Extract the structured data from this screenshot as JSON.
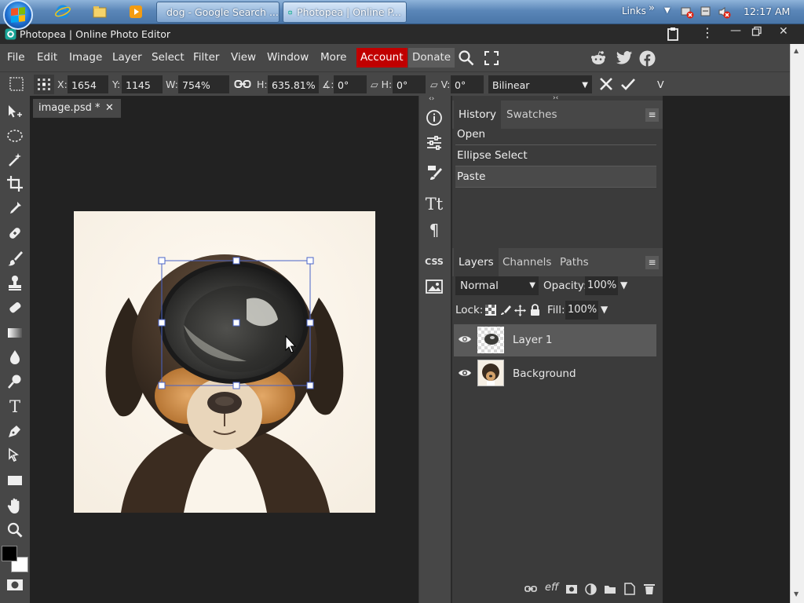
{
  "taskbar": {
    "tabs": [
      {
        "label": "dog - Google Search ...",
        "icon": "chrome-icon"
      },
      {
        "label": "Photopea | Online P...",
        "icon": "photopea-icon"
      }
    ],
    "links_label": "Links",
    "links_chevron": "»",
    "clock": "12:17 AM"
  },
  "app": {
    "title": "Photopea | Online Photo Editor"
  },
  "menu": {
    "items": [
      "File",
      "Edit",
      "Image",
      "Layer",
      "Select",
      "Filter",
      "View",
      "Window",
      "More"
    ],
    "account": "Account",
    "donate": "Donate",
    "account_color": "#c00000"
  },
  "transform": {
    "x_label": "X:",
    "x_value": "1654 px",
    "y_label": "Y:",
    "y_value": "1145 px",
    "w_label": "W:",
    "w_value": "754%",
    "h_label": "H:",
    "h_value": "635.81%",
    "angle_label": "∡:",
    "angle_value": "0°",
    "skew_h_label": "▱ H:",
    "skew_h_value": "0°",
    "skew_v_label": "▱ V:",
    "skew_v_value": "0°",
    "interpolation": "Bilinear",
    "extra": "V"
  },
  "document": {
    "tab_label": "image.psd *"
  },
  "history": {
    "tabs": [
      "History",
      "Swatches"
    ],
    "items": [
      "Open",
      "Ellipse Select",
      "Paste"
    ]
  },
  "layers": {
    "tabs": [
      "Layers",
      "Channels",
      "Paths"
    ],
    "blend_mode": "Normal",
    "opacity_label": "Opacity:",
    "opacity_value": "100%",
    "lock_label": "Lock:",
    "fill_label": "Fill:",
    "fill_value": "100%",
    "items": [
      "Layer 1",
      "Background"
    ],
    "footer_eff": "eff"
  },
  "side_icons": {
    "css_label": "CSS"
  },
  "colors": {
    "accent_account": "#c00000",
    "panel_bg": "#474747",
    "workspace_bg": "#222222"
  }
}
